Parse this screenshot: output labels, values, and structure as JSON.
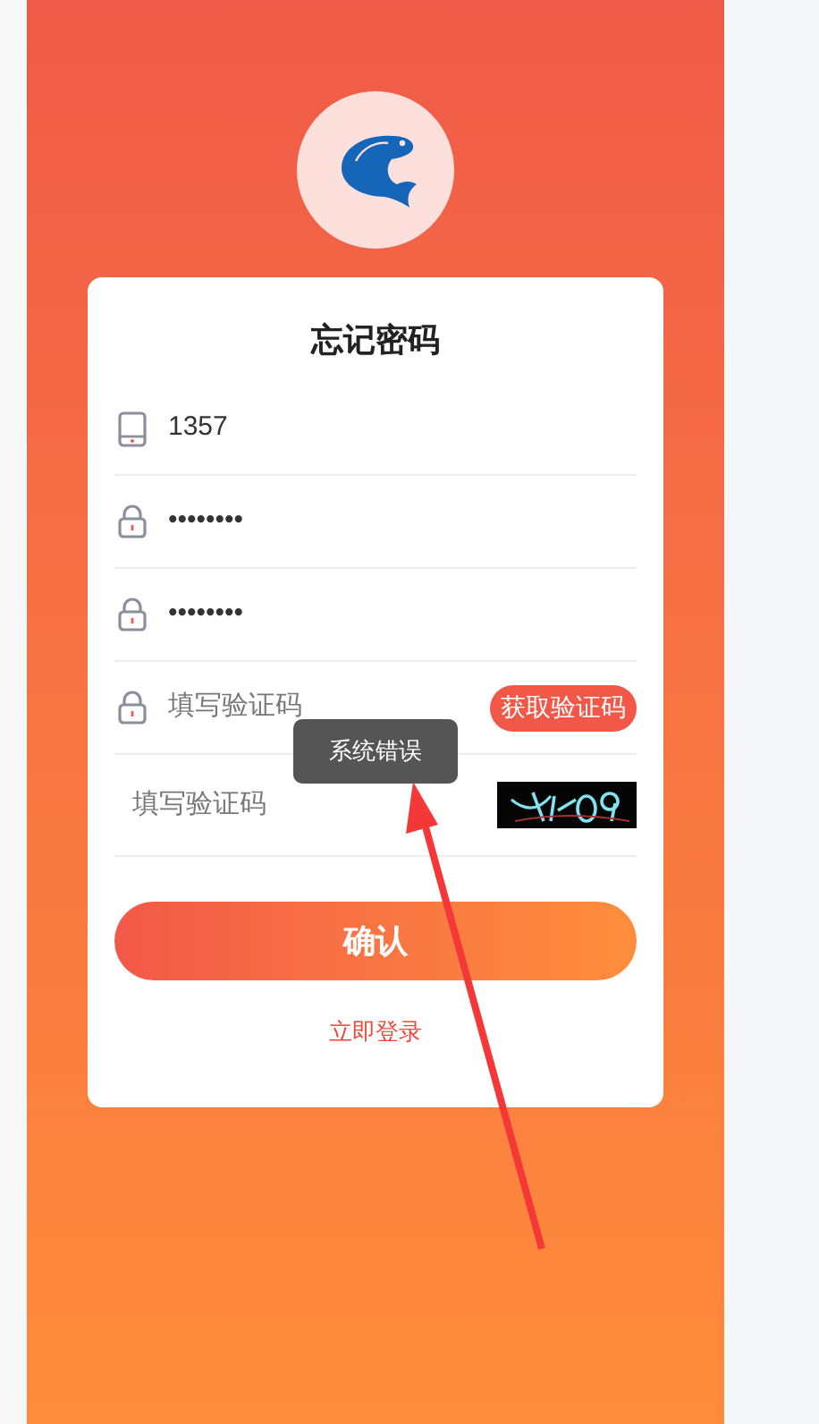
{
  "title": "忘记密码",
  "fields": [
    {
      "kind": "phone",
      "value": "1357"
    },
    {
      "kind": "password",
      "value": "••••••••"
    },
    {
      "kind": "password",
      "value": "••••••••"
    },
    {
      "kind": "sms",
      "placeholder": "填写验证码",
      "button": "获取验证码"
    },
    {
      "kind": "captcha",
      "placeholder": "填写验证码"
    }
  ],
  "submit": "确认",
  "login_link": "立即登录",
  "toast": "系统错误"
}
